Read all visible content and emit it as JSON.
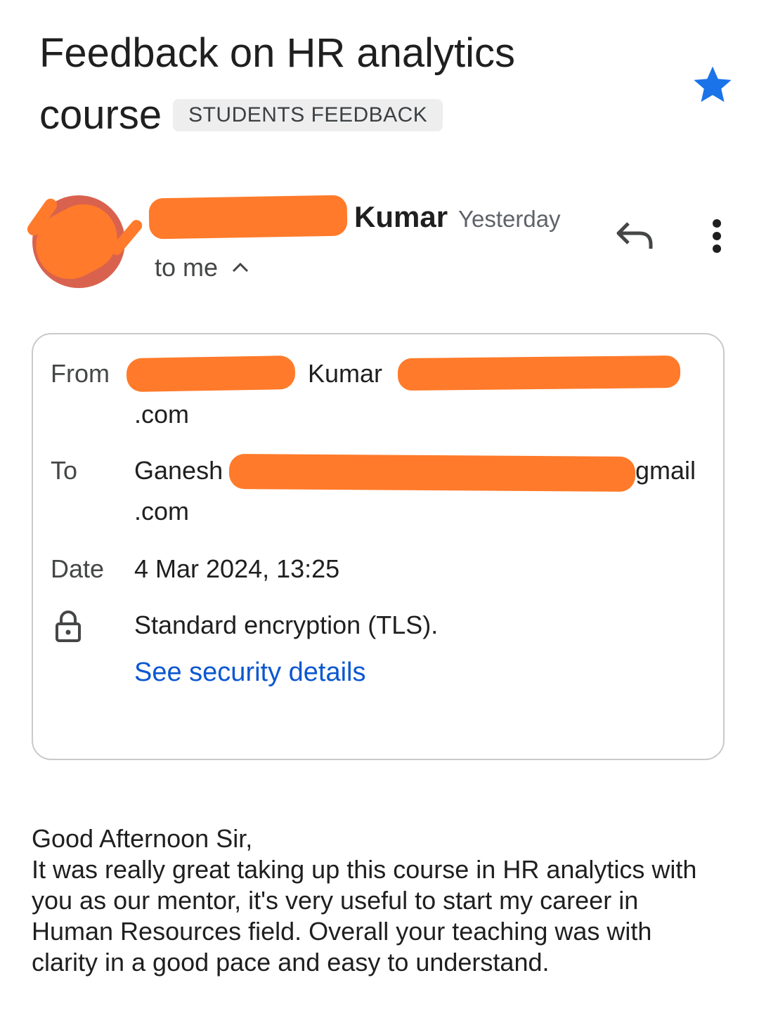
{
  "subject": {
    "line1": "Feedback on HR analytics",
    "line2": "course",
    "label_chip": "STUDENTS FEEDBACK",
    "starred": true
  },
  "sender": {
    "name_visible": "Kumar",
    "time": "Yesterday",
    "recipient_summary": "to me",
    "avatar_color": "#d9624f"
  },
  "actions": {
    "reply_icon": "reply-icon",
    "more_icon": "more-vert-icon",
    "star_icon": "star-icon",
    "star_color": "#1a73e8"
  },
  "details": {
    "from_label": "From",
    "from_name_visible": "Kumar",
    "from_email_suffix": ".com",
    "to_label": "To",
    "to_name_visible": "Ganesh",
    "to_email_visible": "gmail",
    "to_email_suffix": ".com",
    "date_label": "Date",
    "date_value": "4 Mar 2024, 13:25",
    "encryption_icon": "lock-icon",
    "encryption_text": "Standard encryption (TLS).",
    "security_link": "See security details",
    "link_color": "#0b57d0"
  },
  "redaction_color": "#ff7a2a",
  "body": {
    "greeting": "Good Afternoon Sir,",
    "line1": "It was really great taking up this course in HR analytics with",
    "line2": "you as our mentor, it's very useful to start my career in",
    "line3": "Human Resources field. Overall your teaching was with",
    "line4": "clarity in a good pace and easy to understand."
  }
}
